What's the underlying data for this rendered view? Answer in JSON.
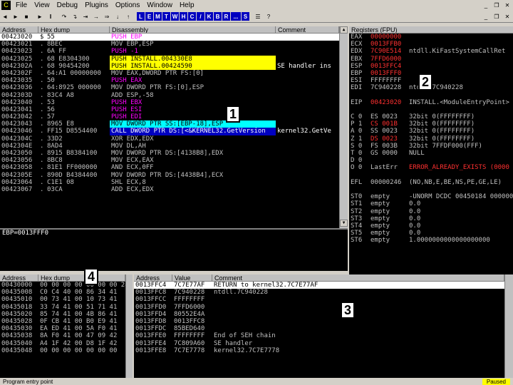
{
  "menu": {
    "logo": "C",
    "items": [
      "File",
      "View",
      "Debug",
      "Plugins",
      "Options",
      "Window",
      "Help"
    ]
  },
  "toolbar": {
    "buttons": [
      "◄",
      "►",
      "■",
      "↷",
      "↴",
      "⇥",
      "→",
      "⇒",
      "↓",
      "↑"
    ],
    "letters": [
      "L",
      "E",
      "M",
      "T",
      "W",
      "H",
      "C",
      "/",
      "K",
      "B",
      "R",
      "...",
      "S"
    ]
  },
  "cpu": {
    "headers": [
      "Address",
      "Hex dump",
      "Disassembly",
      "Comment"
    ],
    "rows": [
      {
        "addr": "00423020",
        "mark": "$",
        "hex": "55",
        "dis": "PUSH EBP",
        "cm": "",
        "style": "sel"
      },
      {
        "addr": "00423021",
        "mark": ".",
        "hex": "8BEC",
        "dis": "MOV EBP,ESP",
        "cm": ""
      },
      {
        "addr": "00423023",
        "mark": ".",
        "hex": "6A FF",
        "dis": "PUSH -1",
        "cm": ""
      },
      {
        "addr": "00423025",
        "mark": ".",
        "hex": "68 E8304300",
        "dis": "PUSH INSTALL.004330E8",
        "cm": "",
        "hl": "ylw"
      },
      {
        "addr": "0042302A",
        "mark": ".",
        "hex": "68 90454200",
        "dis": "PUSH INSTALL.00424590",
        "cm": "SE handler ins",
        "hl": "ylw"
      },
      {
        "addr": "0042302F",
        "mark": ".",
        "hex": "64:A1 00000000",
        "dis": "MOV EAX,DWORD PTR FS:[0]",
        "cm": ""
      },
      {
        "addr": "00423035",
        "mark": ".",
        "hex": "50",
        "dis": "PUSH EAX",
        "cm": ""
      },
      {
        "addr": "00423036",
        "mark": ".",
        "hex": "64:8925 000000",
        "dis": "MOV DWORD PTR FS:[0],ESP",
        "cm": ""
      },
      {
        "addr": "0042303D",
        "mark": ".",
        "hex": "83C4 A8",
        "dis": "ADD ESP,-58",
        "cm": ""
      },
      {
        "addr": "00423040",
        "mark": ".",
        "hex": "53",
        "dis": "PUSH EBX",
        "cm": ""
      },
      {
        "addr": "00423041",
        "mark": ".",
        "hex": "56",
        "dis": "PUSH ESI",
        "cm": ""
      },
      {
        "addr": "00423042",
        "mark": ".",
        "hex": "57",
        "dis": "PUSH EDI",
        "cm": ""
      },
      {
        "addr": "00423043",
        "mark": ".",
        "hex": "8965 E8",
        "dis": "MOV DWORD PTR SS:[EBP-18],ESP",
        "cm": "",
        "hl": "cy"
      },
      {
        "addr": "00423046",
        "mark": ".",
        "hex": "FF15 D8554400",
        "dis": "CALL DWORD PTR DS:[<&KERNEL32.GetVersion",
        "cm": "kernel32.GetVe",
        "hl": "call"
      },
      {
        "addr": "0042304C",
        "mark": ".",
        "hex": "33D2",
        "dis": "XOR EDX,EDX",
        "cm": ""
      },
      {
        "addr": "0042304E",
        "mark": ".",
        "hex": "8AD4",
        "dis": "MOV DL,AH",
        "cm": ""
      },
      {
        "addr": "00423050",
        "mark": ".",
        "hex": "8915 B8384100",
        "dis": "MOV DWORD PTR DS:[4138B8],EDX",
        "cm": ""
      },
      {
        "addr": "00423056",
        "mark": ".",
        "hex": "8BC8",
        "dis": "MOV ECX,EAX",
        "cm": ""
      },
      {
        "addr": "00423058",
        "mark": ".",
        "hex": "81E1 FF000000",
        "dis": "AND ECX,0FF",
        "cm": ""
      },
      {
        "addr": "0042305E",
        "mark": ".",
        "hex": "890D B4384400",
        "dis": "MOV DWORD PTR DS:[4438B4],ECX",
        "cm": ""
      },
      {
        "addr": "00423064",
        "mark": ".",
        "hex": "C1E1 08",
        "dis": "SHL ECX,8",
        "cm": ""
      },
      {
        "addr": "00423067",
        "mark": ".",
        "hex": "03CA",
        "dis": "ADD ECX,EDX",
        "cm": ""
      }
    ],
    "info": "EBP=0013FFF0"
  },
  "registers": {
    "title": "Registers (FPU)",
    "rows": [
      {
        "n": "EAX",
        "v": "00000000",
        "c": "",
        "red": true
      },
      {
        "n": "ECX",
        "v": "0013FFB0",
        "c": "",
        "red": true
      },
      {
        "n": "EDX",
        "v": "7C90E514",
        "c": "ntdll.KiFastSystemCallRet",
        "red": true
      },
      {
        "n": "EBX",
        "v": "7FFD6000",
        "c": "",
        "red": true
      },
      {
        "n": "ESP",
        "v": "0013FFC4",
        "c": "",
        "red": true
      },
      {
        "n": "EBP",
        "v": "0013FFF0",
        "c": "",
        "red": true
      },
      {
        "n": "ESI",
        "v": "FFFFFFFF",
        "c": ""
      },
      {
        "n": "EDI",
        "v": "7C940228",
        "c": "ntdll.7C940228"
      },
      {
        "n": "",
        "v": "",
        "c": ""
      },
      {
        "n": "EIP",
        "v": "00423020",
        "c": "INSTALL.<ModuleEntryPoint>",
        "red": true
      },
      {
        "n": "",
        "v": "",
        "c": ""
      },
      {
        "n": "C 0",
        "v": "ES 0023",
        "c": "32bit 0(FFFFFFFF)"
      },
      {
        "n": "P 1",
        "v": "CS 001B",
        "c": "32bit 0(FFFFFFFF)",
        "red": true
      },
      {
        "n": "A 0",
        "v": "SS 0023",
        "c": "32bit 0(FFFFFFFF)"
      },
      {
        "n": "Z 1",
        "v": "DS 0023",
        "c": "32bit 0(FFFFFFFF)",
        "red": true
      },
      {
        "n": "S 0",
        "v": "FS 003B",
        "c": "32bit 7FFDF000(FFF)"
      },
      {
        "n": "T 0",
        "v": "GS 0000",
        "c": "NULL"
      },
      {
        "n": "D 0",
        "v": "",
        "c": ""
      },
      {
        "n": "O 0",
        "v": "LastErr",
        "c": "ERROR_ALREADY_EXISTS (0000"
      },
      {
        "n": "",
        "v": "",
        "c": ""
      },
      {
        "n": "EFL",
        "v": "00000246",
        "c": "(NO,NB,E,BE,NS,PE,GE,LE)"
      },
      {
        "n": "",
        "v": "",
        "c": ""
      },
      {
        "n": "ST0",
        "v": "empty",
        "c": "-UNORM DCDC 00450184 00000000"
      },
      {
        "n": "ST1",
        "v": "empty",
        "c": "0.0"
      },
      {
        "n": "ST2",
        "v": "empty",
        "c": "0.0"
      },
      {
        "n": "ST3",
        "v": "empty",
        "c": "0.0"
      },
      {
        "n": "ST4",
        "v": "empty",
        "c": "0.0"
      },
      {
        "n": "ST5",
        "v": "empty",
        "c": "0.0"
      },
      {
        "n": "ST6",
        "v": "empty",
        "c": "1.0000000000000000000"
      }
    ]
  },
  "dump": {
    "headers": [
      "Address",
      "Hex dump"
    ],
    "rows": [
      {
        "a": "00430000",
        "h": "00 00 00 00 00 00 00 24 40"
      },
      {
        "a": "00435008",
        "h": "C0 C4 40 00 86 34 41"
      },
      {
        "a": "00435010",
        "h": "00 73 41 00 10 73 41"
      },
      {
        "a": "00435018",
        "h": "33 74 41 00 51 71 41"
      },
      {
        "a": "00435020",
        "h": "85 74 41 00 4B 86 41"
      },
      {
        "a": "00435028",
        "h": "0F CB 41 00 B0 E9 41"
      },
      {
        "a": "00435030",
        "h": "EA ED 41 00 5A F0 41"
      },
      {
        "a": "00435038",
        "h": "8A F0 41 00 47 09 42"
      },
      {
        "a": "00435040",
        "h": "A4 1F 42 00 D8 1F 42"
      },
      {
        "a": "00435048",
        "h": "00 00 00 00 00 00 00"
      }
    ]
  },
  "stack": {
    "headers": [
      "Address",
      "Value",
      "Comment"
    ],
    "rows": [
      {
        "a": "0013FFC4",
        "v": "7C7E77AF",
        "c": "RETURN to kernel32.7C7E77AF",
        "sel": true
      },
      {
        "a": "0013FFC8",
        "v": "7C940228",
        "c": "ntdll.7C940228"
      },
      {
        "a": "0013FFCC",
        "v": "FFFFFFFF",
        "c": ""
      },
      {
        "a": "0013FFD0",
        "v": "7FFD6000",
        "c": ""
      },
      {
        "a": "0013FFD4",
        "v": "80552E4A",
        "c": ""
      },
      {
        "a": "0013FFD8",
        "v": "0013FFC8",
        "c": ""
      },
      {
        "a": "0013FFDC",
        "v": "85BED640",
        "c": ""
      },
      {
        "a": "0013FFE0",
        "v": "FFFFFFFF",
        "c": "End of SEH chain"
      },
      {
        "a": "0013FFE4",
        "v": "7C809A60",
        "c": "SE handler"
      },
      {
        "a": "0013FFE8",
        "v": "7C7E7778",
        "c": "kernel32.7C7E7778"
      }
    ]
  },
  "markers": [
    "1",
    "2",
    "3",
    "4"
  ],
  "status": {
    "left": "Program entry point",
    "right": "Paused"
  }
}
